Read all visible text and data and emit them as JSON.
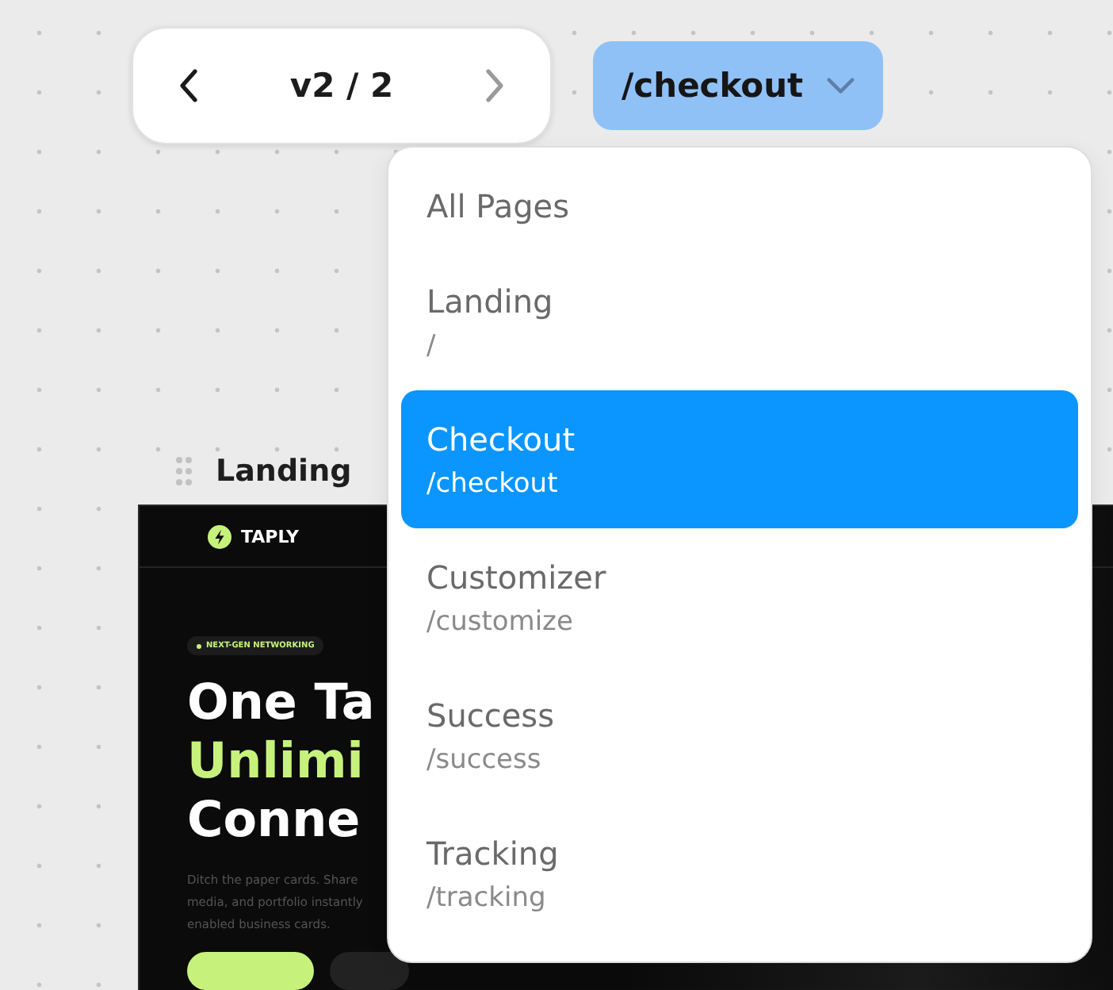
{
  "version_nav": {
    "label": "v2 / 2",
    "prev_disabled": false,
    "next_disabled": true
  },
  "page_select": {
    "value": "/checkout",
    "expanded": true
  },
  "page_options": [
    {
      "name": "All Pages",
      "selected": false
    },
    {
      "name": "Landing",
      "path": "/",
      "selected": false
    },
    {
      "name": "Checkout",
      "path": "/checkout",
      "selected": true
    },
    {
      "name": "Customizer",
      "path": "/customize",
      "selected": false
    },
    {
      "name": "Success",
      "path": "/success",
      "selected": false
    },
    {
      "name": "Tracking",
      "path": "/tracking",
      "selected": false
    }
  ],
  "preview": {
    "label": "Landing",
    "site": {
      "brand": "TAPLY",
      "badge": "NEXT-GEN NETWORKING",
      "headline": [
        {
          "text": "One Ta",
          "accent": false
        },
        {
          "text": "Unlimi",
          "accent": true
        },
        {
          "text": "Conne",
          "accent": false
        }
      ],
      "description": [
        "Ditch the paper cards. Share",
        "media, and portfolio instantly",
        "enabled business cards."
      ]
    }
  }
}
